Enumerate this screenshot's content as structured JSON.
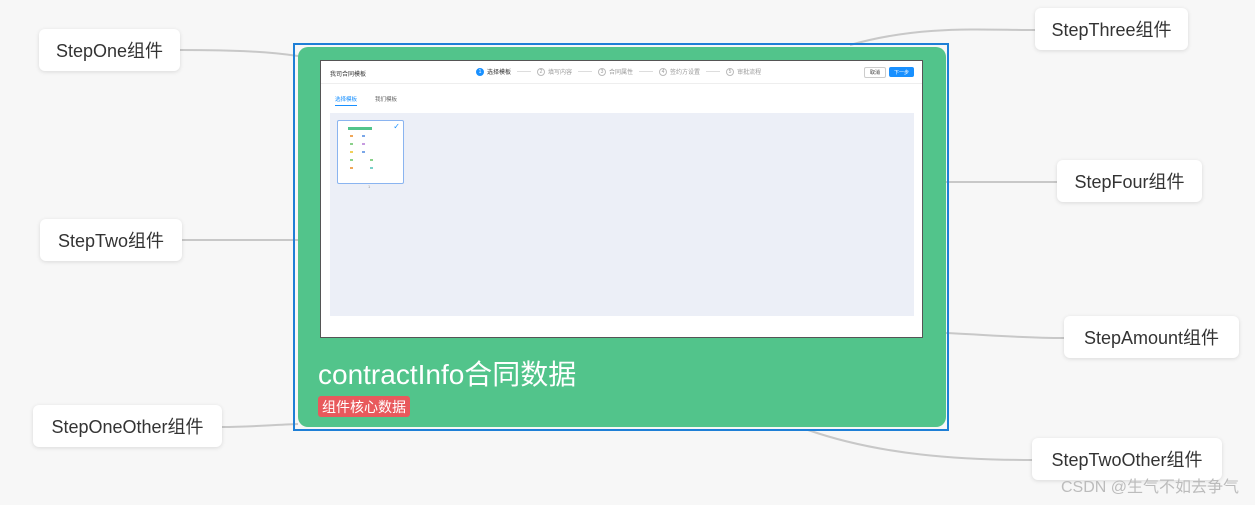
{
  "center": {
    "title": "contractInfo合同数据",
    "badge": "组件核心数据",
    "screenshot": {
      "title": "我司合同模板",
      "steps": [
        {
          "num": "1",
          "label": "选择模板",
          "active": true
        },
        {
          "num": "2",
          "label": "填写内容",
          "active": false
        },
        {
          "num": "3",
          "label": "合同属性",
          "active": false
        },
        {
          "num": "4",
          "label": "签约方设置",
          "active": false
        },
        {
          "num": "5",
          "label": "审批流程",
          "active": false
        }
      ],
      "cancel_label": "取消",
      "next_label": "下一步",
      "tabs": [
        "选择模板",
        "我们模板"
      ],
      "template_index": "1"
    }
  },
  "nodes": {
    "step_one": "StepOne组件",
    "step_two": "StepTwo组件",
    "step_one_other": "StepOneOther组件",
    "step_three": "StepThree组件",
    "step_four": "StepFour组件",
    "step_amount": "StepAmount组件",
    "step_two_other": "StepTwoOther组件"
  },
  "watermark": "CSDN @生气不如去争气",
  "colors": {
    "center_card": "#52c48b",
    "frame": "#1e7fd6",
    "badge": "#e8595c",
    "link": "#c8c8c8"
  }
}
